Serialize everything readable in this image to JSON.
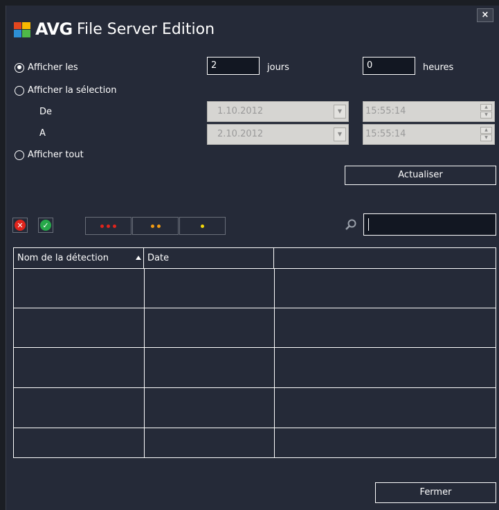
{
  "window": {
    "brand": "AVG",
    "title": "File Server Edition",
    "close_label": "×"
  },
  "range": {
    "option_days": "Afficher les",
    "days_value": "2",
    "days_label": "jours",
    "hours_value": "0",
    "hours_label": "heures",
    "option_selection": "Afficher la sélection",
    "from_label": "De",
    "to_label": "A",
    "from_date": "1.10.2012",
    "from_time": "15:55:14",
    "to_date": "2.10.2012",
    "to_time": "15:55:14",
    "option_all": "Afficher tout",
    "selected": "option_days"
  },
  "refresh_label": "Actualiser",
  "filters": {
    "remove_icon": "red-x-icon",
    "ok_icon": "green-check-icon",
    "high_severity": "three-red-dots",
    "medium_severity": "two-orange-dots",
    "low_severity": "one-yellow-dot"
  },
  "search": {
    "value": ""
  },
  "table": {
    "columns": [
      "Nom de la détection",
      "Date",
      ""
    ],
    "sorted_column": "Nom de la détection",
    "rows": []
  },
  "close_label": "Fermer",
  "colors": {
    "background": "#252a38",
    "red": "#e0241c",
    "green": "#27a84a",
    "orange": "#f39c12",
    "yellow": "#f5d90a"
  }
}
